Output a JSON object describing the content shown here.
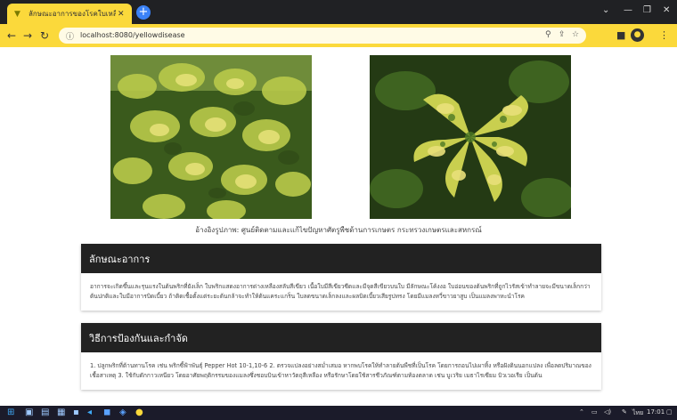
{
  "browser": {
    "tab_title": "ลักษณะอาการของโรคใบเหลืองในพริก",
    "url": "localhost:8080/yellowdisease",
    "new_tab_icon": "+",
    "accent_color": "#fbd93b"
  },
  "page": {
    "caption": "อ้างอิงรูปภาพ: ศูนย์ติดตามและแก้ไขปัญหาศัตรูพืชด้านการเกษตร กระทรวงเกษตรและสหกรณ์",
    "symptoms": {
      "heading": "ลักษณะอาการ",
      "text": "อาการจะเกิดขึ้นและรุนแรงในต้นพริกที่ยังเล็ก ใบพริกแสดงอาการด่างเหลืองสลับสีเขียว เนื้อใบมีสีเขียวซีดและมีจุดสีเขียวบนใบ มีลักษณะโค้งงอ ใบอ่อนของต้นพริกที่ถูกไวรัสเข้าทำลายจะมีขนาดเล็กกว่าต้นปกติและใบมีอาการบิดเบี้ยว ถ้าติดเชื้อตั้งแต่ระยะต้นกล้าจะทำให้ต้นแคระแกร็น ใบลดขนาดเล็กลงและผลบิดเบี้ยวเสียรูปทรง โดยมีแมลงหวี่ขาวยาสูบ เป็นแมลงพาหะนำโรค"
    },
    "control": {
      "heading": "วิธีการป้องกันและกำจัด",
      "text": "1. ปลูกพริกที่ต้านทานโรค เช่น พริกซี้ฟ้าพันธุ์ Pepper Hot 10-1,10-6 2. ตรวจแปลงอย่างสม่ำเสมอ หากพบโรคให้ทำลายต้นพืชที่เป็นโรค โดยการถอนไปเผาทิ้ง หรือฝังดินนอกแปลง เพื่อลดปริมาณของเชื้อสาเหตุ 3. ใช้กับดักกาวเหนียว โดยอาศัยพฤติกรรมของแมลงซึ่งชอบบินเข้าหาวัตถุสีเหลือง หรือรักษาโดยใช้สารชีวภัณฑ์ตามท้องตลาด เช่น บูเวริย เมธาไรเซียม บิวเวอเรีย เป็นต้น"
    }
  },
  "taskbar": {
    "clock": "17:01",
    "lang": "ไทย"
  }
}
